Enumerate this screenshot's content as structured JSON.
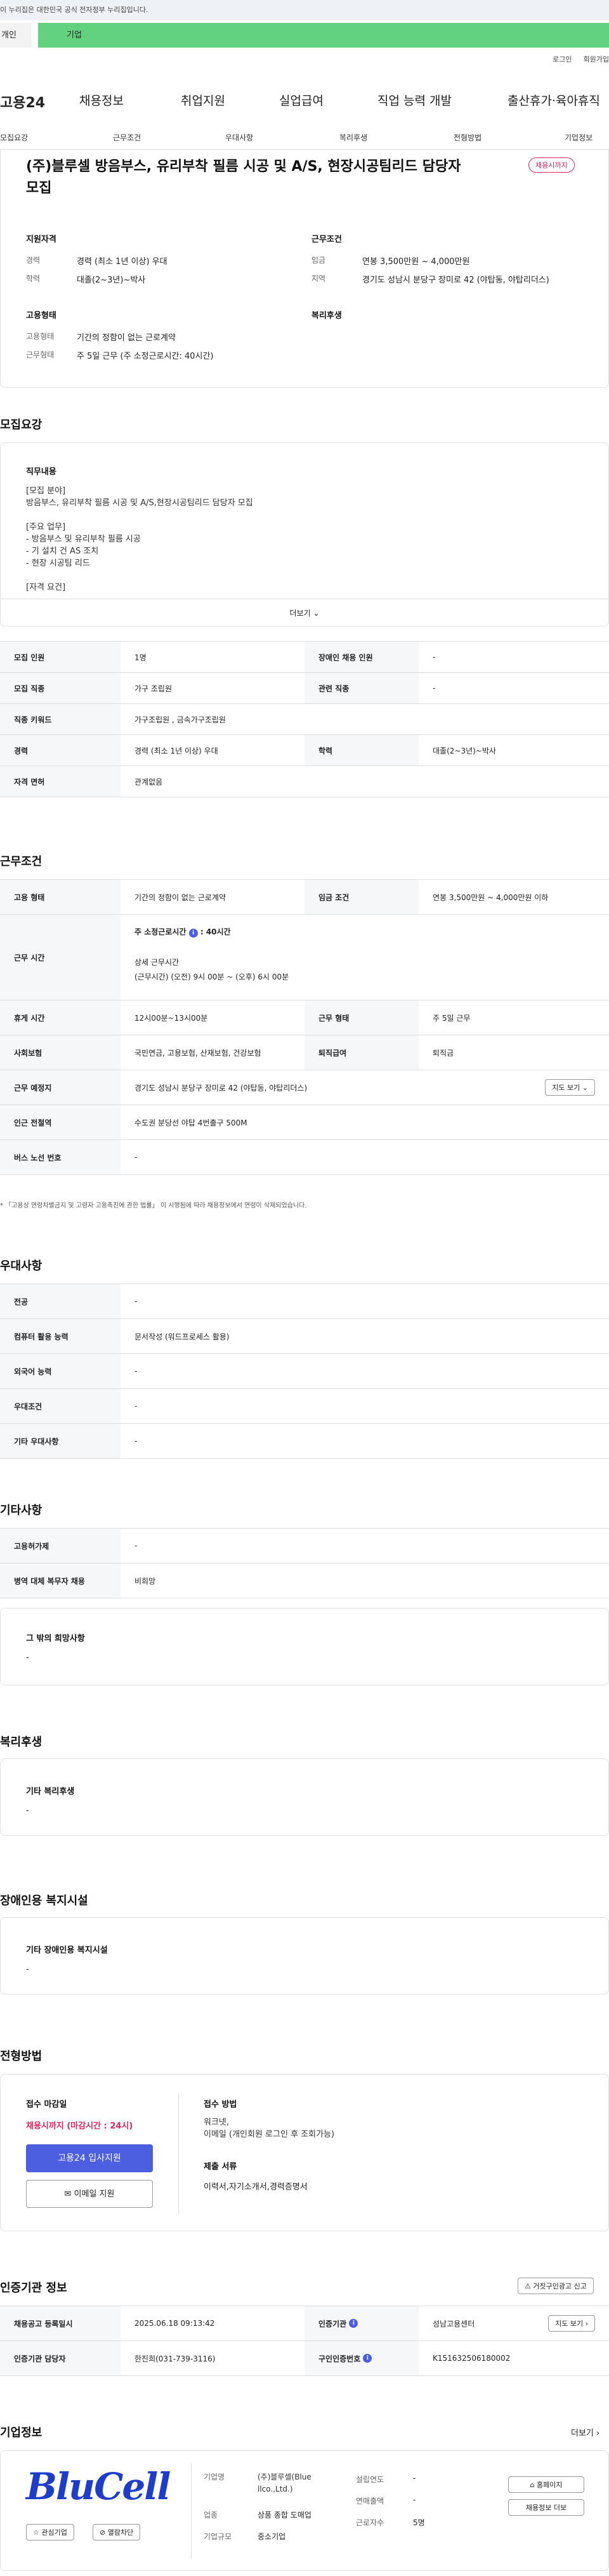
{
  "gov_notice": "이 누리집은 대한민국 공식 전자정부 누리집입니다.",
  "tabs": [
    "개인",
    "기업"
  ],
  "top_links": [
    "로그인",
    "회원가입"
  ],
  "gnb": [
    "고용24",
    "채용정보",
    "취업지원",
    "실업급여",
    "직업 능력 개발",
    "출산휴가·육아휴직"
  ],
  "subnav": [
    "모집요강",
    "근무조건",
    "우대사항",
    "복리후생",
    "전형방법",
    "기업정보"
  ],
  "header": {
    "title": "(주)블루셀 방음부스, 유리부착 필름 시공 및 A/S, 현장시공팀리드 담당자 모집",
    "badge": "채용시까지",
    "qual_title": "지원자격",
    "qual": [
      {
        "k": "경력",
        "v": "경력 (최소 1년 이상) 우대"
      },
      {
        "k": "학력",
        "v": "대졸(2~3년)~박사"
      }
    ],
    "cond_title": "근무조건",
    "cond": [
      {
        "k": "임금",
        "v": "연봉 3,500만원 ~ 4,000만원"
      },
      {
        "k": "지역",
        "v": "경기도 성남시 분당구 장미로 42 (야탑동, 야탑리더스)"
      }
    ],
    "emp_title": "고용형태",
    "emp": [
      {
        "k": "고용형태",
        "v": "기간의 정함이 없는 근로계약"
      },
      {
        "k": "근무형태",
        "v": "주 5일 근무 (주 소정근로시간: 40시간)"
      }
    ],
    "welfare_title": "복리후생"
  },
  "recruit": {
    "title": "모집요강",
    "duty_title": "직무내용",
    "duty_text": "[모집 분야]\n방음부스, 유리부착 필름 시공 및 A/S,현장시공팀리드 담당자 모집\n\n[주요 업무]\n- 방음부스 및 유리부착 필름 시공\n- 기 설치 건 AS 조치\n- 현장 시공팀 리드\n\n[자격 요건]",
    "more": "더보기",
    "rows": [
      {
        "k1": "모집 인원",
        "v1": "1명",
        "k2": "장애인 채용 인원",
        "v2": "-"
      },
      {
        "k1": "모집 직종",
        "v1": "가구 조립원",
        "k2": "관련 직종",
        "v2": "-"
      },
      {
        "k1": "직종 키워드",
        "v1": "가구조립원 , 금속가구조립원"
      },
      {
        "k1": "경력",
        "v1": "경력 (최소 1년 이상) 우대",
        "k2": "학력",
        "v2": "대졸(2~3년)~박사"
      },
      {
        "k1": "자격 면허",
        "v1": "관계없음"
      }
    ]
  },
  "work": {
    "title": "근무조건",
    "employ_k": "고용 형태",
    "employ_v": "기간의 정함이 없는 근로계약",
    "wage_k": "임금 조건",
    "wage_v": "연봉 3,500만원 ~ 4,000만원 이하",
    "time_k": "근무 시간",
    "time_sub1": "주 소정근로시간",
    "time_sub1_v": "40시간",
    "time_sub2": "상세 근무시간",
    "time_sub2_v": "(근무시간) (오전) 9시 00분 ~ (오후) 6시 00분",
    "rows": [
      {
        "k1": "휴게 시간",
        "v1": "12시00분~13시00분",
        "k2": "근무 형태",
        "v2": "주 5일 근무"
      },
      {
        "k1": "사회보험",
        "v1": "국민연금, 고용보험, 산재보험, 건강보험",
        "k2": "퇴직급여",
        "v2": "퇴직금"
      }
    ],
    "place_k": "근무 예정지",
    "place_v": "경기도 성남시 분당구 장미로 42 (야탑동, 야탑리더스)",
    "map_btn": "지도 보기",
    "station_k": "인근 전철역",
    "station_v": "수도권 분당선 야탑 4번출구 500M",
    "bus_k": "버스 노선 번호",
    "bus_v": "-",
    "note": "* 「고용상 연령차별금지 및 고령자 고용촉진에 관한 법률」 이 시행됨에 따라 채용정보에서 연령이 삭제되었습니다."
  },
  "pref": {
    "title": "우대사항",
    "rows": [
      {
        "k": "전공",
        "v": "-"
      },
      {
        "k": "컴퓨터 활용 능력",
        "v": "문서작성 (워드프로세스 활용)"
      },
      {
        "k": "외국어 능력",
        "v": "-"
      },
      {
        "k": "우대조건",
        "v": "-"
      },
      {
        "k": "기타 우대사항",
        "v": "-"
      }
    ]
  },
  "etc": {
    "title": "기타사항",
    "rows": [
      {
        "k": "고용허가제",
        "v": "-"
      },
      {
        "k": "병역 대체 복무자 채용",
        "v": "비희망"
      }
    ],
    "wish_title": "그 밖의 희망사항",
    "wish_v": "-"
  },
  "welfare": {
    "title": "복리후생",
    "sub": "기타 복리후생",
    "v": "-"
  },
  "disabled": {
    "title": "장애인용 복지시설",
    "sub": "기타 장애인용 복지시설",
    "v": "-"
  },
  "apply": {
    "title": "전형방법",
    "deadline_k": "접수 마감일",
    "deadline_v": "채용시까지 (마감시간 : 24시)",
    "btn1": "고용24 입사지원",
    "btn2": "이메일 지원",
    "method_k": "접수 방법",
    "method_v": "워크넷,\n이메일 (개인회원 로그인 후 조회가능)",
    "docs_k": "제출 서류",
    "docs_v": "이력서,자기소개서,경력증명서"
  },
  "cert": {
    "title": "인증기관 정보",
    "report": "거짓구인광고 신고",
    "rows": [
      {
        "k1": "채용공고 등록일시",
        "v1": "2025.06.18 09:13:42",
        "k2": "인증기관",
        "v2": "성남고용센터",
        "btn": "지도 보기"
      },
      {
        "k1": "인증기관 담당자",
        "v1": "한진희(031-739-3116)",
        "k2": "구인인증번호",
        "v2": "K151632506180002"
      }
    ]
  },
  "company": {
    "title": "기업정보",
    "more": "더보기",
    "logo": "BluCell",
    "fav": "관심기업",
    "block": "열람차단",
    "f": [
      {
        "k": "기업명",
        "v": "(주)블루셀(Blue\nllco.,Ltd.)"
      },
      {
        "k": "업종",
        "v": "상품 종합 도매업"
      },
      {
        "k": "기업규모",
        "v": "중소기업"
      }
    ],
    "f2": [
      {
        "k": "설립연도",
        "v": "-"
      },
      {
        "k": "연매출액",
        "v": "-"
      },
      {
        "k": "근로자수",
        "v": "5명"
      }
    ],
    "btn_home": "홈페이지",
    "btn_list": "채용정보 더보"
  },
  "colors": {
    "accent": "#4c5fe0",
    "green": "#62d27e",
    "red": "#e0245e"
  }
}
